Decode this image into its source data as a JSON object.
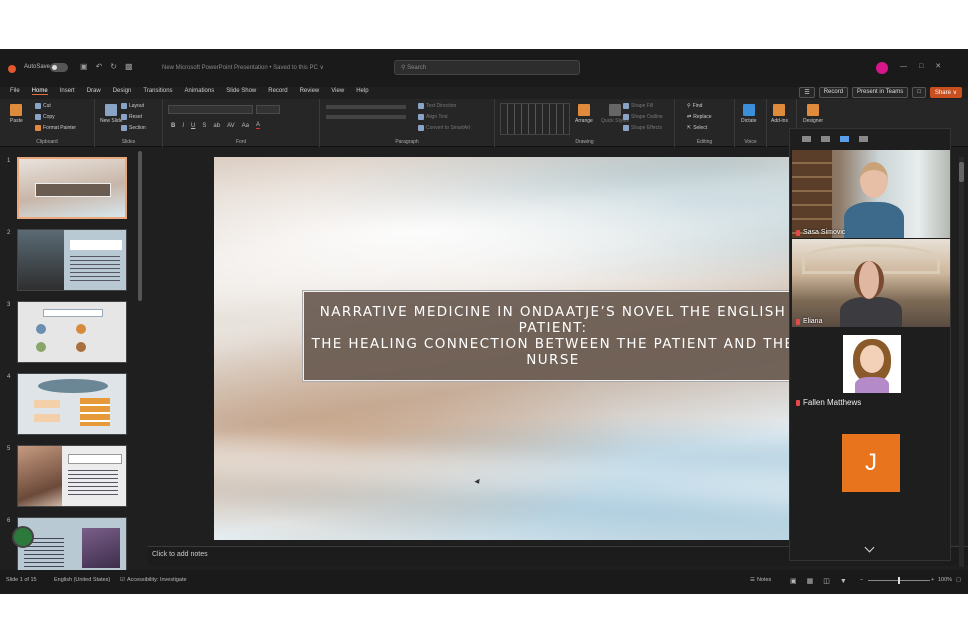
{
  "titlebar": {
    "autosave_label": "AutoSave",
    "autosave_state": "Off",
    "doc_title": "New Microsoft PowerPoint Presentation  •  Saved to this PC ∨",
    "search_placeholder": "Search"
  },
  "menu": {
    "tabs": [
      "File",
      "Home",
      "Insert",
      "Draw",
      "Design",
      "Transitions",
      "Animations",
      "Slide Show",
      "Record",
      "Review",
      "View",
      "Help"
    ],
    "active_tab": "Home",
    "record_label": "Record",
    "present_label": "Present in Teams",
    "share_label": "Share ∨"
  },
  "ribbon": {
    "paste": "Paste",
    "cut": "Cut",
    "copy": "Copy",
    "format_painter": "Format Painter",
    "clipboard": "Clipboard",
    "new_slide": "New Slide",
    "layout": "Layout",
    "reset": "Reset",
    "section": "Section",
    "slides": "Slides",
    "font": "Font",
    "paragraph": "Paragraph",
    "text_direction": "Text Direction",
    "align_text": "Align Text",
    "convert_smartart": "Convert to SmartArt",
    "arrange": "Arrange",
    "quick_styles": "Quick Styles",
    "shape_fill": "Shape Fill",
    "shape_outline": "Shape Outline",
    "shape_effects": "Shape Effects",
    "drawing": "Drawing",
    "find": "Find",
    "replace": "Replace",
    "select": "Select",
    "editing": "Editing",
    "dictate": "Dictate",
    "voice": "Voice",
    "addins": "Add-ins",
    "designer": "Designer"
  },
  "thumbnails": [
    "1",
    "2",
    "3",
    "4",
    "5",
    "6"
  ],
  "slide": {
    "title": "NARRATIVE MEDICINE IN ONDAATJE’S NOVEL THE ENGLISH PATIENT:\nTHE HEALING CONNECTION BETWEEN THE PATIENT AND THE NURSE"
  },
  "notes": {
    "placeholder": "Click to add notes"
  },
  "teams": {
    "participants": [
      {
        "name": "Sasa Simovic"
      },
      {
        "name": "Eliana"
      },
      {
        "name": "Fallen Matthews"
      },
      {
        "name": "J",
        "initial": "J",
        "color": "#e8751e"
      }
    ]
  },
  "status": {
    "slide_count": "Slide 1 of 15",
    "language": "English (United States)",
    "accessibility": "Accessibility: Investigate",
    "notes": "Notes",
    "zoom": "100%"
  },
  "colors": {
    "accent": "#e86f3a",
    "share": "#c94f1e",
    "title_box": "#695a50"
  }
}
